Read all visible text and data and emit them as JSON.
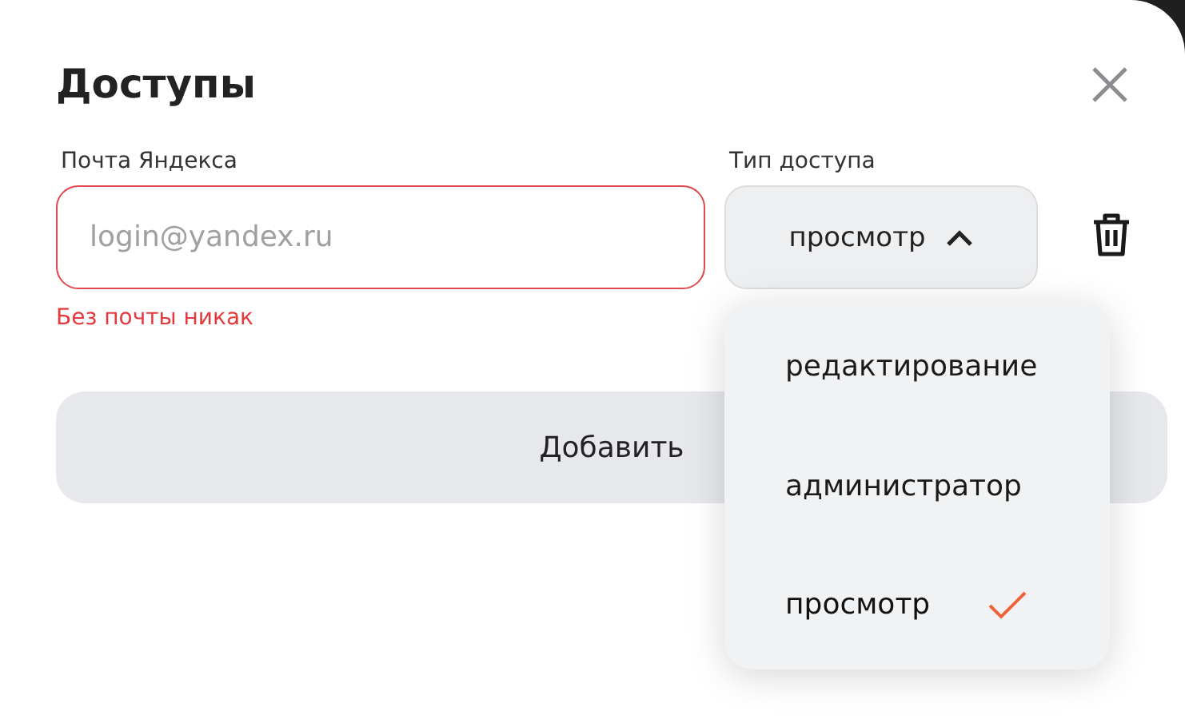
{
  "dialog": {
    "title": "Доступы"
  },
  "email": {
    "label": "Почта Яндекса",
    "placeholder": "login@yandex.ru",
    "error": "Без почты никак"
  },
  "access": {
    "label": "Тип доступа",
    "value": "просмотр",
    "expanded": true
  },
  "options": [
    {
      "label": "редактирование",
      "selected": false
    },
    {
      "label": "администратор",
      "selected": false
    },
    {
      "label": "просмотр",
      "selected": true
    }
  ],
  "add_button": {
    "label": "Добавить"
  }
}
